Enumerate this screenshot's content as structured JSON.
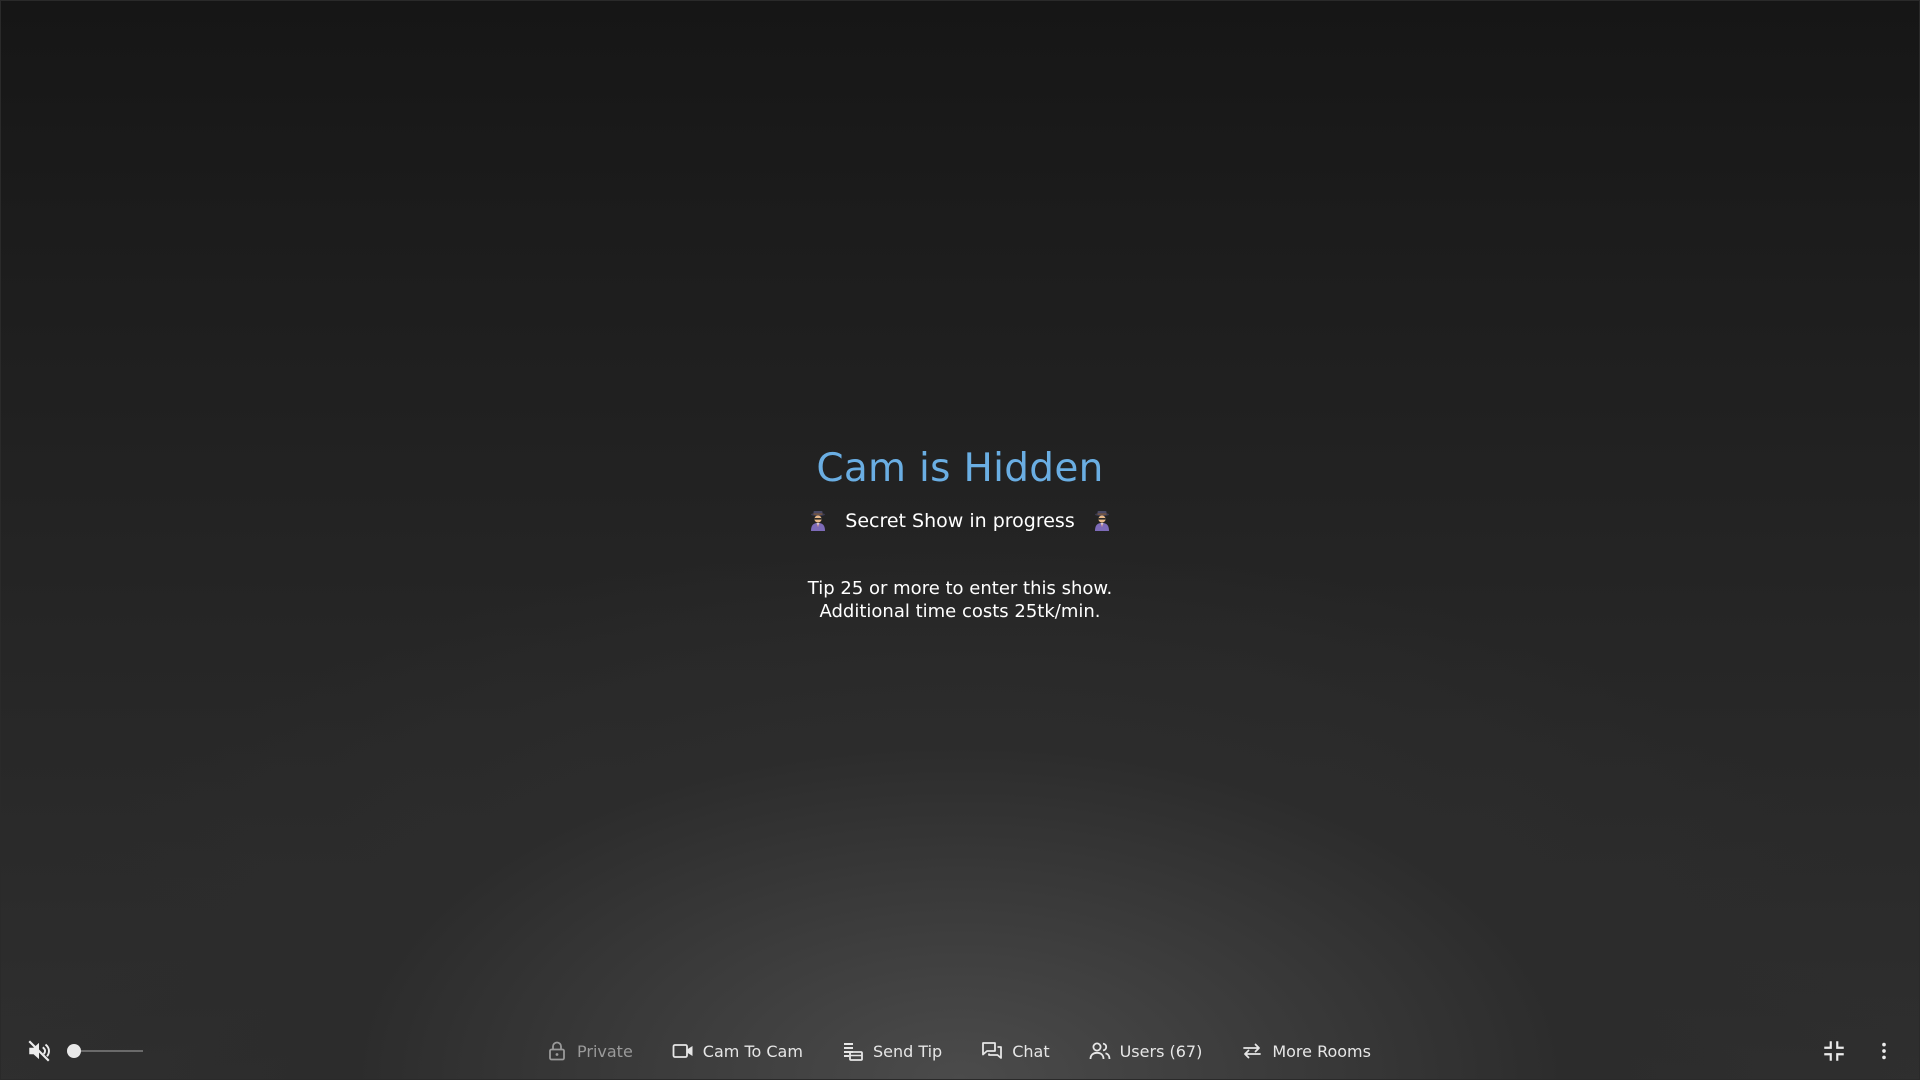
{
  "overlay": {
    "title": "Cam is Hidden",
    "subtitle": "Secret Show in progress",
    "subtitle_icon": "spy-emoji-icon",
    "info_line_1": "Tip 25 or more to enter this show.",
    "info_line_2": "Additional time costs 25tk/min."
  },
  "player": {
    "mute_icon": "volume-muted-icon",
    "volume_level": 0
  },
  "toolbar": {
    "private_label": "Private",
    "cam_to_cam_label": "Cam To Cam",
    "send_tip_label": "Send Tip",
    "chat_label": "Chat",
    "users_label": "Users (67)",
    "more_rooms_label": "More Rooms"
  },
  "colors": {
    "title": "#6aaee3",
    "text": "#ffffff",
    "toolbar_text": "#e6e6e6",
    "disabled_text": "#9a9a9a"
  }
}
